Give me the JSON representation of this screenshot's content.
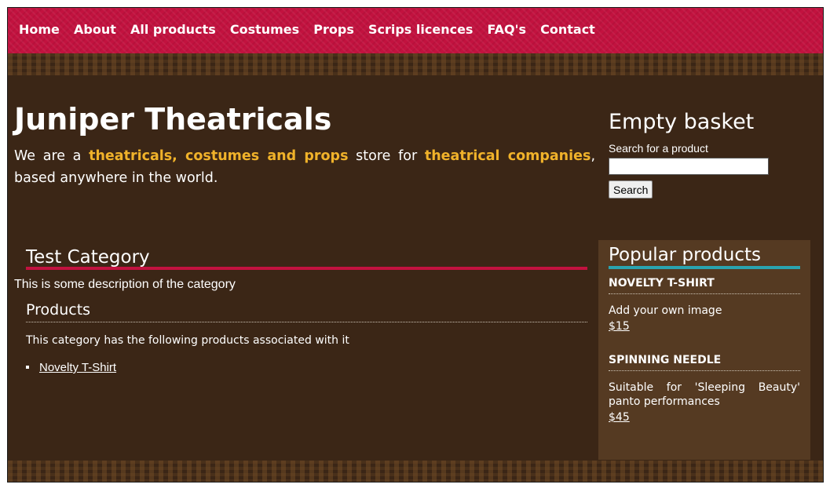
{
  "nav": {
    "items": [
      "Home",
      "About",
      "All products",
      "Costumes",
      "Props",
      "Scrips licences",
      "FAQ's",
      "Contact"
    ]
  },
  "header": {
    "site_title": "Juniper Theatricals",
    "tagline_parts": [
      "We are a ",
      "theatricals, costumes and props",
      " store for ",
      "theatrical companies",
      ", based anywhere in the world."
    ]
  },
  "basket": {
    "title": "Empty basket"
  },
  "search": {
    "label": "Search for a product",
    "value": "",
    "button_label": "Search"
  },
  "category": {
    "title": "Test Category",
    "description": "This is some description of the category",
    "products_heading": "Products",
    "products_intro": "This category has the following products associated with it",
    "products": [
      "Novelty T-Shirt"
    ]
  },
  "popular": {
    "title": "Popular products",
    "items": [
      {
        "name": "NOVELTY T-SHIRT",
        "description": "Add your own image",
        "price": "$15"
      },
      {
        "name": "SPINNING NEEDLE",
        "description": "Suitable for 'Sleeping Beauty' panto performances",
        "price": "$45"
      }
    ]
  },
  "colors": {
    "nav_bg": "#c2123f",
    "page_bg": "#3b2616",
    "highlight": "#f0b22a",
    "sidebar_bg": "#553a22",
    "popular_underline": "#2aa4b0"
  }
}
